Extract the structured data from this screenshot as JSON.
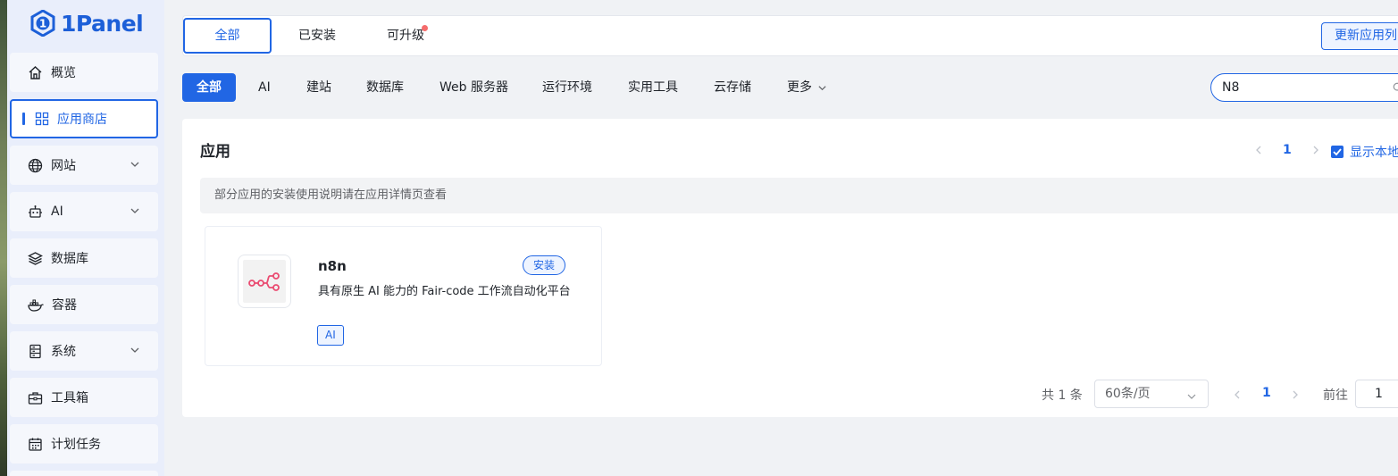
{
  "brand": {
    "name": "1Panel"
  },
  "sidebar": {
    "items": [
      {
        "label": "概览",
        "icon": "home-icon",
        "has_submenu": false
      },
      {
        "label": "应用商店",
        "icon": "apps-grid-icon",
        "has_submenu": false,
        "active": true
      },
      {
        "label": "网站",
        "icon": "globe-icon",
        "has_submenu": true
      },
      {
        "label": "AI",
        "icon": "robot-icon",
        "has_submenu": true
      },
      {
        "label": "数据库",
        "icon": "layers-icon",
        "has_submenu": false
      },
      {
        "label": "容器",
        "icon": "docker-whale-icon",
        "has_submenu": false
      },
      {
        "label": "系统",
        "icon": "server-icon",
        "has_submenu": true
      },
      {
        "label": "工具箱",
        "icon": "toolbox-icon",
        "has_submenu": false
      },
      {
        "label": "计划任务",
        "icon": "calendar-icon",
        "has_submenu": false
      }
    ]
  },
  "tabs": {
    "items": [
      {
        "label": "全部",
        "active": true
      },
      {
        "label": "已安装"
      },
      {
        "label": "可升级",
        "badge_dot": true
      }
    ],
    "update_button": "更新应用列"
  },
  "categories": {
    "items": [
      "全部",
      "AI",
      "建站",
      "数据库",
      "Web 服务器",
      "运行环境",
      "实用工具",
      "云存储",
      "更多"
    ],
    "active_index": 0
  },
  "search": {
    "value": "N8"
  },
  "apps_section": {
    "title": "应用",
    "page": "1",
    "show_local_label": "显示本地",
    "show_local_checked": true,
    "notice": "部分应用的安装使用说明请在应用详情页查看"
  },
  "app_cards": [
    {
      "name": "n8n",
      "install_label": "安装",
      "description": "具有原生 AI 能力的 Fair-code 工作流自动化平台",
      "tag": "AI",
      "icon": "n8n-logo-icon"
    }
  ],
  "pagination": {
    "total": "共 1 条",
    "page_size": "60条/页",
    "current_page": "1",
    "goto_label": "前往",
    "goto_value": "1"
  },
  "colors": {
    "primary": "#2166e4",
    "sidebar_bg": "#e9eefb",
    "badge_dot": "#f56c6c",
    "n8n_brand": "#ea4b71"
  }
}
